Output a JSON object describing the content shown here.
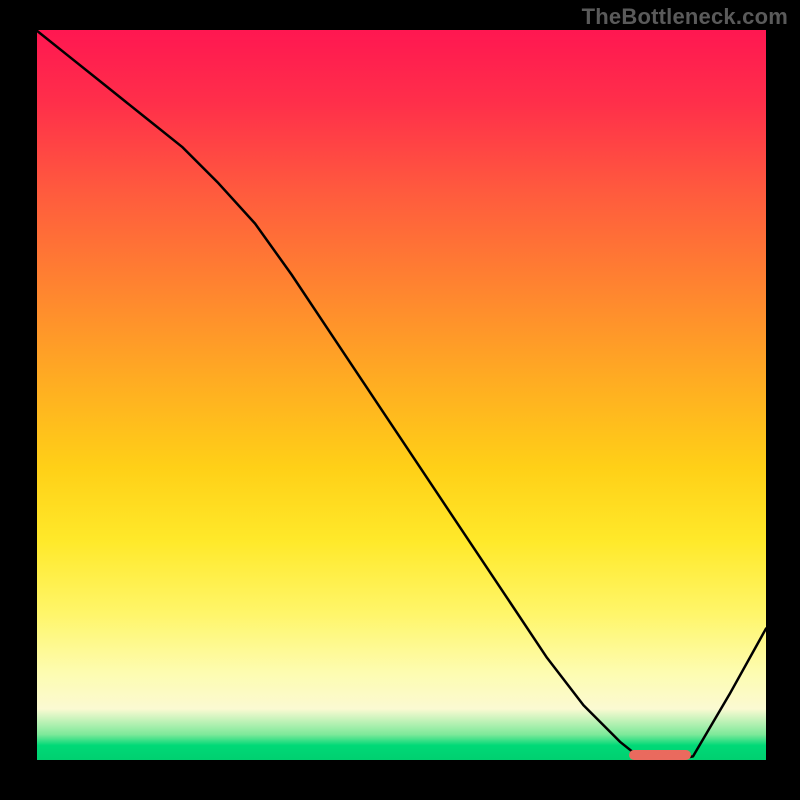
{
  "watermark": "TheBottleneck.com",
  "chart_data": {
    "type": "line",
    "title": "",
    "xlabel": "",
    "ylabel": "",
    "x": [
      0.0,
      0.05,
      0.1,
      0.15,
      0.2,
      0.25,
      0.3,
      0.35,
      0.4,
      0.45,
      0.5,
      0.55,
      0.6,
      0.65,
      0.7,
      0.75,
      0.8,
      0.825,
      0.85,
      0.875,
      0.9,
      0.95,
      1.0
    ],
    "y": [
      1.0,
      0.96,
      0.92,
      0.88,
      0.84,
      0.79,
      0.735,
      0.665,
      0.59,
      0.515,
      0.44,
      0.365,
      0.29,
      0.215,
      0.14,
      0.075,
      0.025,
      0.005,
      0.0,
      0.0,
      0.005,
      0.09,
      0.18
    ],
    "xlim": [
      0,
      1
    ],
    "ylim": [
      0,
      1
    ],
    "marker": {
      "x": 0.855,
      "y": 0.005,
      "label": ""
    },
    "background_gradient": {
      "direction": "vertical",
      "stops": [
        {
          "pos": 0.0,
          "color": "#ff1751"
        },
        {
          "pos": 0.35,
          "color": "#ff8330"
        },
        {
          "pos": 0.7,
          "color": "#ffe92a"
        },
        {
          "pos": 0.93,
          "color": "#fbfad2"
        },
        {
          "pos": 1.0,
          "color": "#00d070"
        }
      ]
    }
  }
}
